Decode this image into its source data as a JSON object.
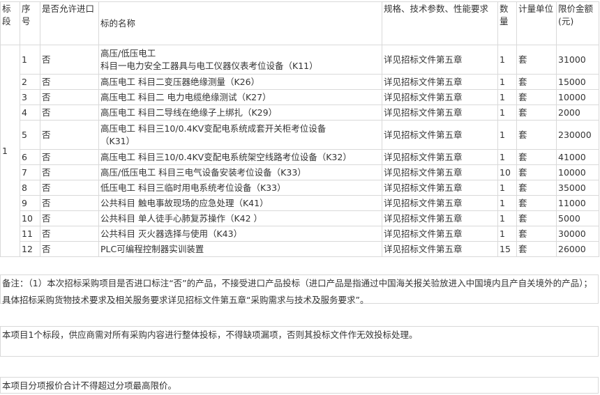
{
  "table": {
    "headers": {
      "segment": "标段",
      "index": "序号",
      "import_allowed": "是否允许进口",
      "name": "标的名称",
      "spec": "规格、技术参数、性能要求",
      "qty": "数量",
      "unit": "计量单位",
      "price": "限价金额(元)"
    },
    "segment_value": "1",
    "rows": [
      {
        "index": "1",
        "import": "否",
        "name_line1": "高压/低压电工",
        "name_line2": "科目一电力安全工器具与电工仪器仪表考位设备（K11）",
        "spec": "详见招标文件第五章",
        "qty": "1",
        "unit": "套",
        "price": "31000"
      },
      {
        "index": "2",
        "import": "否",
        "name": "高压电工 科目二变压器绝缘测量（K26）",
        "spec": "详见招标文件第五章",
        "qty": "1",
        "unit": "套",
        "price": "15000"
      },
      {
        "index": "3",
        "import": "否",
        "name": "高压电工 科目二 电力电缆绝缘测试（K27）",
        "spec": "详见招标文件第五章",
        "qty": "1",
        "unit": "套",
        "price": "10000"
      },
      {
        "index": "4",
        "import": "否",
        "name": "高压电工 科目二导线在绝缘子上绑扎（K29）",
        "spec": "详见招标文件第五章",
        "qty": "1",
        "unit": "套",
        "price": "2000"
      },
      {
        "index": "5",
        "import": "否",
        "name_line1": "高压电工 科目三10/0.4KV变配电系统成套开关柜考位设备",
        "name_line2": "（K31）",
        "spec": "详见招标文件第五章",
        "qty": "1",
        "unit": "套",
        "price": "230000"
      },
      {
        "index": "6",
        "import": "否",
        "name": "高压电工 科目三10/0.4KV变配电系统架空线路考位设备（K32）",
        "spec": "详见招标文件第五章",
        "qty": "1",
        "unit": "套",
        "price": "41000"
      },
      {
        "index": "7",
        "import": "否",
        "name": "高压/低压电工 科目三电气设备安装考位设备（K33）",
        "spec": "详见招标文件第五章",
        "qty": "10",
        "unit": "套",
        "price": "10000"
      },
      {
        "index": "8",
        "import": "否",
        "name": "低压电工 科目三临时用电系统考位设备（K33）",
        "spec": "详见招标文件第五章",
        "qty": "1",
        "unit": "套",
        "price": "35000"
      },
      {
        "index": "9",
        "import": "否",
        "name": "公共科目 触电事故现场的应急处理（K41）",
        "spec": "详见招标文件第五章",
        "qty": "1",
        "unit": "套",
        "price": "11000"
      },
      {
        "index": "10",
        "import": "否",
        "name": "公共科目 单人徒手心肺复苏操作（K42 ）",
        "spec": "详见招标文件第五章",
        "qty": "1",
        "unit": "套",
        "price": "5000"
      },
      {
        "index": "11",
        "import": "否",
        "name": "公共科目 灭火器选择与使用（K43）",
        "spec": "详见招标文件第五章",
        "qty": "1",
        "unit": "套",
        "price": "30000"
      },
      {
        "index": "12",
        "import": "否",
        "name": "PLC可编程控制器实训装置",
        "spec": "详见招标文件第五章",
        "qty": "15",
        "unit": "套",
        "price": "26000"
      }
    ]
  },
  "notes": {
    "note1": "备注：（1）本次招标采购项目是否进口标注“否”的产品，不接受进口产品投标（进口产品是指通过中国海关报关验放进入中国境内且产自关境外的产品）；具体招标采购货物技术要求及相关服务要求详见招标文件第五章“采购需求与技术及服务要求”。",
    "note2": "本项目1个标段，供应商需对所有采购内容进行整体投标，不得缺项漏项，否则其投标文件作无效投标处理。",
    "note3": "本项目分项报价合计不得超过分项最高限价。"
  }
}
